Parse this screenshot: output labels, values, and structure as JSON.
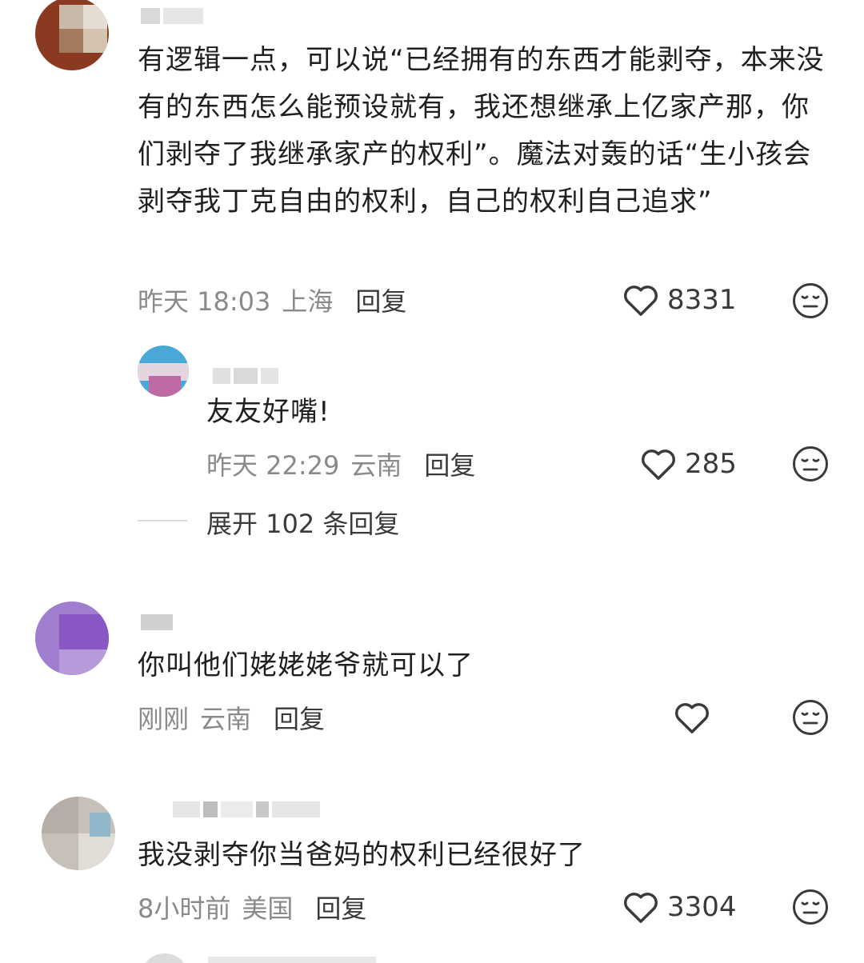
{
  "comments": [
    {
      "text": "有逻辑一点，可以说“已经拥有的东西才能剥夺，本来没有的东西怎么能预设就有，我还想继承上亿家产那，你们剥夺了我继承家产的权利”。魔法对轰的话“生小孩会剥夺我丁克自由的权利，自己的权利自己追求”",
      "time": "昨天 18:03",
      "location": "上海",
      "reply_label": "回复",
      "likes": "8331"
    },
    {
      "text": "友友好嘴!",
      "time": "昨天 22:29",
      "location": "云南",
      "reply_label": "回复",
      "likes": "285",
      "expand_label": "展开 102 条回复"
    },
    {
      "text": "你叫他们姥姥姥爷就可以了",
      "time": "刚刚",
      "location": "云南",
      "reply_label": "回复",
      "likes": ""
    },
    {
      "text": "我没剥夺你当爸妈的权利已经很好了",
      "time": "8小时前",
      "location": "美国",
      "reply_label": "回复",
      "likes": "3304"
    }
  ],
  "icons": {
    "like": "heart-outline-icon",
    "reaction": "meh-face-icon"
  },
  "colors": {
    "text": "#202020",
    "meta": "#8a8a8a",
    "action": "#3a3a3a"
  }
}
